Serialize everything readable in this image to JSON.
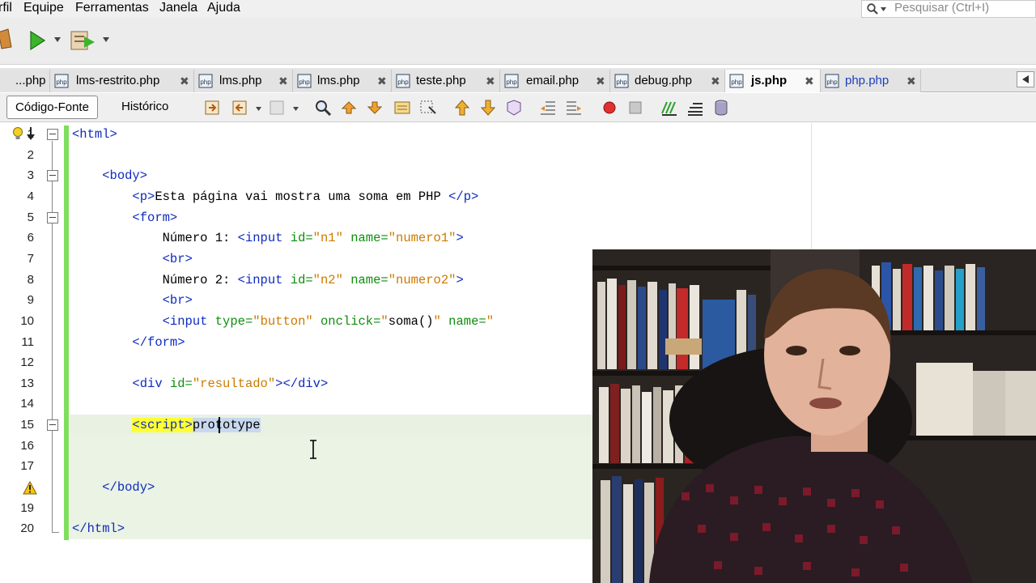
{
  "menu": {
    "items": [
      "rfil",
      "Equipe",
      "Ferramentas",
      "Janela",
      "Ajuda"
    ]
  },
  "search": {
    "placeholder": "Pesquisar (Ctrl+I)"
  },
  "tabs": [
    {
      "label": "...php",
      "active": false,
      "closable": false
    },
    {
      "label": "lms-restrito.php",
      "active": false,
      "closable": true
    },
    {
      "label": "lms.php",
      "active": false,
      "closable": true
    },
    {
      "label": "lms.php",
      "active": false,
      "closable": true
    },
    {
      "label": "teste.php",
      "active": false,
      "closable": true
    },
    {
      "label": "email.php",
      "active": false,
      "closable": true
    },
    {
      "label": "debug.php",
      "active": false,
      "closable": true
    },
    {
      "label": "js.php",
      "active": true,
      "closable": true
    },
    {
      "label": "php.php",
      "active": false,
      "closable": true,
      "link": true
    }
  ],
  "editor_toolbar": {
    "source_label": "Código-Fonte",
    "history_label": "Histórico"
  },
  "code": {
    "line_numbers": [
      "1",
      "2",
      "3",
      "4",
      "5",
      "6",
      "7",
      "8",
      "9",
      "10",
      "11",
      "12",
      "13",
      "14",
      "15",
      "16",
      "17",
      "",
      "19",
      "20"
    ],
    "lines": [
      [
        {
          "t": "tag",
          "v": "<html>"
        }
      ],
      [],
      [
        {
          "t": "txt",
          "v": "    "
        },
        {
          "t": "tag",
          "v": "<body>"
        }
      ],
      [
        {
          "t": "txt",
          "v": "        "
        },
        {
          "t": "tag",
          "v": "<p>"
        },
        {
          "t": "txt",
          "v": "Esta página vai mostra uma soma em PHP "
        },
        {
          "t": "tag",
          "v": "</p>"
        }
      ],
      [
        {
          "t": "txt",
          "v": "        "
        },
        {
          "t": "tag",
          "v": "<form>"
        }
      ],
      [
        {
          "t": "txt",
          "v": "            Número 1: "
        },
        {
          "t": "tag",
          "v": "<input "
        },
        {
          "t": "attr",
          "v": "id="
        },
        {
          "t": "val",
          "v": "\"n1\""
        },
        {
          "t": "txt",
          "v": " "
        },
        {
          "t": "attr",
          "v": "name="
        },
        {
          "t": "val",
          "v": "\"numero1\""
        },
        {
          "t": "tag",
          "v": ">"
        }
      ],
      [
        {
          "t": "txt",
          "v": "            "
        },
        {
          "t": "tag",
          "v": "<br>"
        }
      ],
      [
        {
          "t": "txt",
          "v": "            Número 2: "
        },
        {
          "t": "tag",
          "v": "<input "
        },
        {
          "t": "attr",
          "v": "id="
        },
        {
          "t": "val",
          "v": "\"n2\""
        },
        {
          "t": "txt",
          "v": " "
        },
        {
          "t": "attr",
          "v": "name="
        },
        {
          "t": "val",
          "v": "\"numero2\""
        },
        {
          "t": "tag",
          "v": ">"
        }
      ],
      [
        {
          "t": "txt",
          "v": "            "
        },
        {
          "t": "tag",
          "v": "<br>"
        }
      ],
      [
        {
          "t": "txt",
          "v": "            "
        },
        {
          "t": "tag",
          "v": "<input "
        },
        {
          "t": "attr",
          "v": "type="
        },
        {
          "t": "val",
          "v": "\"button\""
        },
        {
          "t": "txt",
          "v": " "
        },
        {
          "t": "attr",
          "v": "onclick="
        },
        {
          "t": "val",
          "v": "\""
        },
        {
          "t": "txt",
          "v": "soma()"
        },
        {
          "t": "val",
          "v": "\""
        },
        {
          "t": "txt",
          "v": " "
        },
        {
          "t": "attr",
          "v": "name="
        },
        {
          "t": "val",
          "v": "\""
        }
      ],
      [
        {
          "t": "txt",
          "v": "        "
        },
        {
          "t": "tag",
          "v": "</form>"
        }
      ],
      [],
      [
        {
          "t": "txt",
          "v": "        "
        },
        {
          "t": "tag",
          "v": "<div "
        },
        {
          "t": "attr",
          "v": "id="
        },
        {
          "t": "val",
          "v": "\"resultado\""
        },
        {
          "t": "tag",
          "v": "></div>"
        }
      ],
      [],
      [
        {
          "t": "txt",
          "v": "        "
        },
        {
          "t": "hl-tag",
          "v": "<script>"
        },
        {
          "t": "sel",
          "v": "prototype"
        }
      ],
      [],
      [],
      [
        {
          "t": "txt",
          "v": "    "
        },
        {
          "t": "tag",
          "v": "</body>"
        }
      ],
      [],
      [
        {
          "t": "tag",
          "v": "</html>"
        }
      ]
    ]
  },
  "colors": {
    "tag": "#0f2bbd",
    "attribute": "#0f8e0f",
    "value": "#cc7a00",
    "change_bar": "#7ede5d",
    "tag_highlight": "#ffff33"
  }
}
